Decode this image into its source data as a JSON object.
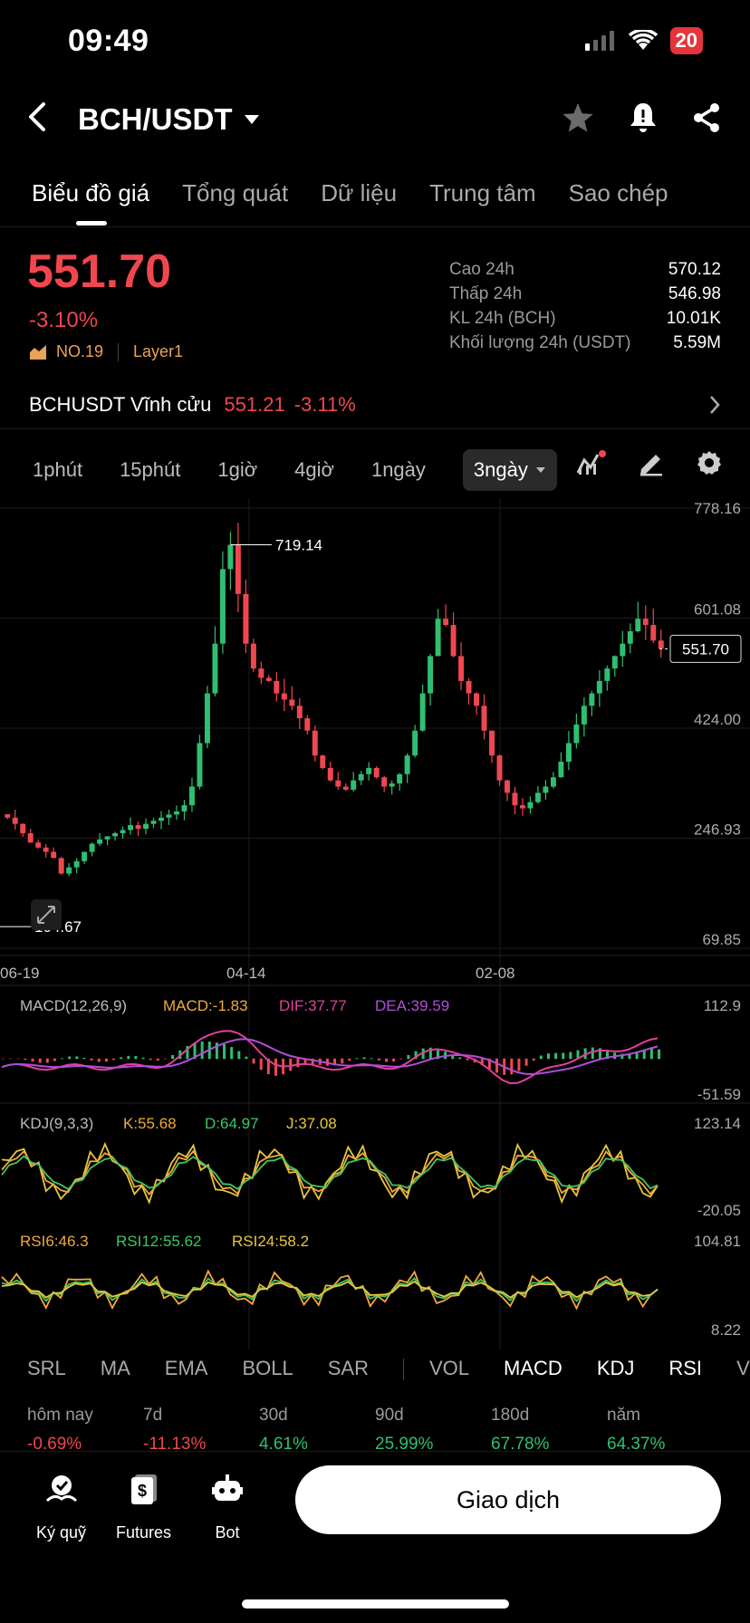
{
  "status": {
    "time": "09:49",
    "battery": "20"
  },
  "header": {
    "pair": "BCH/USDT"
  },
  "tabs": [
    "Biểu đồ giá",
    "Tổng quát",
    "Dữ liệu",
    "Trung tâm",
    "Sao chép"
  ],
  "price": {
    "last": "551.70",
    "change": "-3.10%",
    "rank": "NO.19",
    "category": "Layer1"
  },
  "stats": [
    {
      "label": "Cao 24h",
      "value": "570.12"
    },
    {
      "label": "Thấp 24h",
      "value": "546.98"
    },
    {
      "label": "KL 24h (BCH)",
      "value": "10.01K"
    },
    {
      "label": "Khối lượng 24h (USDT)",
      "value": "5.59M"
    }
  ],
  "perpetual": {
    "label": "BCHUSDT Vĩnh cửu",
    "price": "551.21",
    "change": "-3.11%"
  },
  "timeframes": [
    "1phút",
    "15phút",
    "1giờ",
    "4giờ",
    "1ngày"
  ],
  "timeframe_selected": "3ngày",
  "chart_data": {
    "type": "candlestick",
    "y_axis_labels": [
      "778.16",
      "601.08",
      "424.00",
      "246.93",
      "69.85"
    ],
    "x_axis_labels": [
      "06-19",
      "04-14",
      "02-08"
    ],
    "max_marker": "719.14",
    "min_marker": "104.67",
    "current_price_tag": "551.70",
    "closes_approx": [
      280,
      270,
      255,
      240,
      232,
      225,
      215,
      190,
      200,
      210,
      225,
      238,
      245,
      250,
      255,
      260,
      268,
      262,
      270,
      275,
      280,
      285,
      290,
      300,
      330,
      400,
      480,
      560,
      680,
      719,
      640,
      560,
      520,
      505,
      500,
      480,
      470,
      460,
      440,
      420,
      380,
      360,
      340,
      330,
      325,
      340,
      350,
      360,
      345,
      330,
      335,
      350,
      380,
      420,
      480,
      540,
      600,
      590,
      540,
      500,
      480,
      460,
      420,
      380,
      340,
      320,
      300,
      295,
      305,
      320,
      330,
      345,
      370,
      400,
      430,
      460,
      480,
      500,
      520,
      540,
      560,
      580,
      600,
      590,
      565,
      552
    ],
    "macd": {
      "params": "MACD(12,26,9)",
      "macd": "MACD:-1.83",
      "dif": "DIF:37.77",
      "dea": "DEA:39.59",
      "max": "112.9",
      "min": "-51.59"
    },
    "kdj": {
      "params": "KDJ(9,3,3)",
      "k": "K:55.68",
      "d": "D:64.97",
      "j": "J:37.08",
      "max": "123.14",
      "min": "-20.05"
    },
    "rsi": {
      "rsi6": "RSI6:46.3",
      "rsi12": "RSI12:55.62",
      "rsi24": "RSI24:58.2",
      "max": "104.81",
      "min": "8.22"
    },
    "colors": {
      "up": "#2fbf71",
      "down": "#f0474f",
      "macd_dif": "#e0409a",
      "macd_dea": "#b14ddb",
      "k": "#f2a93b",
      "d": "#3ec763",
      "j": "#e8c83a"
    }
  },
  "indicator_tabs": [
    "SRL",
    "MA",
    "EMA",
    "BOLL",
    "SAR",
    "VOL",
    "MACD",
    "KDJ",
    "RSI",
    "V"
  ],
  "performance": [
    {
      "period": "hôm nay",
      "value": "-0.69%",
      "dir": "neg"
    },
    {
      "period": "7d",
      "value": "-11.13%",
      "dir": "neg"
    },
    {
      "period": "30d",
      "value": "4.61%",
      "dir": "pos"
    },
    {
      "period": "90d",
      "value": "25.99%",
      "dir": "pos"
    },
    {
      "period": "180d",
      "value": "67.78%",
      "dir": "pos"
    },
    {
      "period": "năm",
      "value": "64.37%",
      "dir": "pos"
    }
  ],
  "bottom_nav": [
    {
      "label": "Ký quỹ",
      "icon": "margin-icon"
    },
    {
      "label": "Futures",
      "icon": "futures-icon"
    },
    {
      "label": "Bot",
      "icon": "bot-icon"
    }
  ],
  "trade_button": "Giao dịch"
}
